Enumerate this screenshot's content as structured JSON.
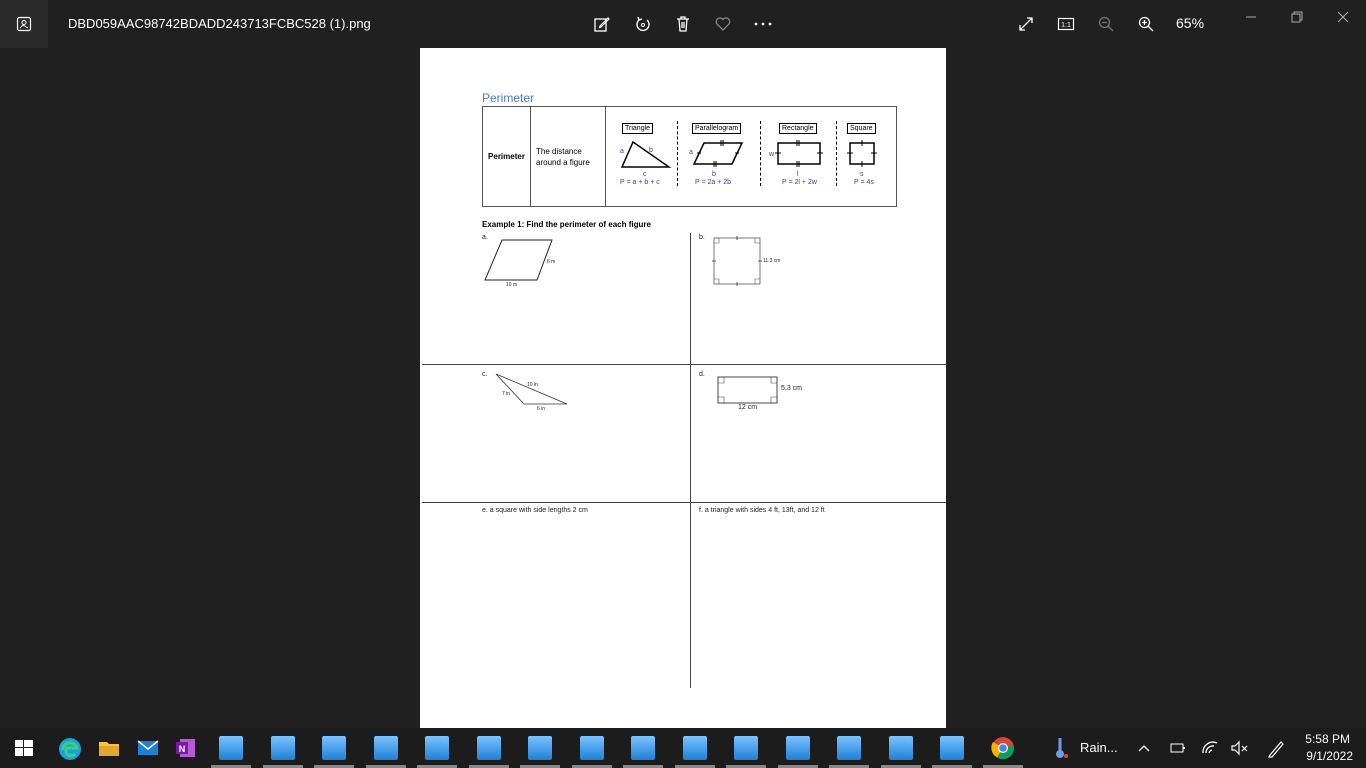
{
  "window": {
    "filename": "DBD059AAC98742BDADD243713FCBC528 (1).png",
    "zoom": "65%",
    "icons": [
      "edit-icon",
      "rotate-icon",
      "delete-icon",
      "favorite-icon",
      "more-icon",
      "fullscreen-icon",
      "actual-size-icon",
      "zoom-out-icon",
      "zoom-in-icon"
    ]
  },
  "document": {
    "title": "Perimeter",
    "ref_term": "Perimeter",
    "ref_definition_line1": "The distance",
    "ref_definition_line2": "around a figure",
    "shapes": [
      {
        "name": "Triangle",
        "formula": "P = a + b + c",
        "labels": [
          "a",
          "b",
          "c"
        ]
      },
      {
        "name": "Parallelogram",
        "formula": "P = 2a + 2b",
        "labels": [
          "a",
          "b"
        ]
      },
      {
        "name": "Rectangle",
        "formula": "P = 2l + 2w",
        "labels": [
          "w",
          "l"
        ]
      },
      {
        "name": "Square",
        "formula": "P = 4s",
        "labels": [
          "s"
        ]
      }
    ],
    "example_title": "Example 1:  Find the perimeter of each figure",
    "a": {
      "label": "a.",
      "side": "6 m",
      "base": "10 m"
    },
    "b": {
      "label": "b.",
      "side": "11.3 cm"
    },
    "c": {
      "label": "c.",
      "s1": "10 in",
      "s2": "7 in",
      "s3": "6 in"
    },
    "d": {
      "label": "d.",
      "height": "5.3 cm",
      "width": "12 cm"
    },
    "e": "e.  a square with side lengths 2 cm",
    "f": "f.  a triangle with sides 4 ft, 13ft, and 12 ft"
  },
  "taskbar": {
    "weather": "Rain...",
    "time": "5:58 PM",
    "date": "9/1/2022"
  }
}
